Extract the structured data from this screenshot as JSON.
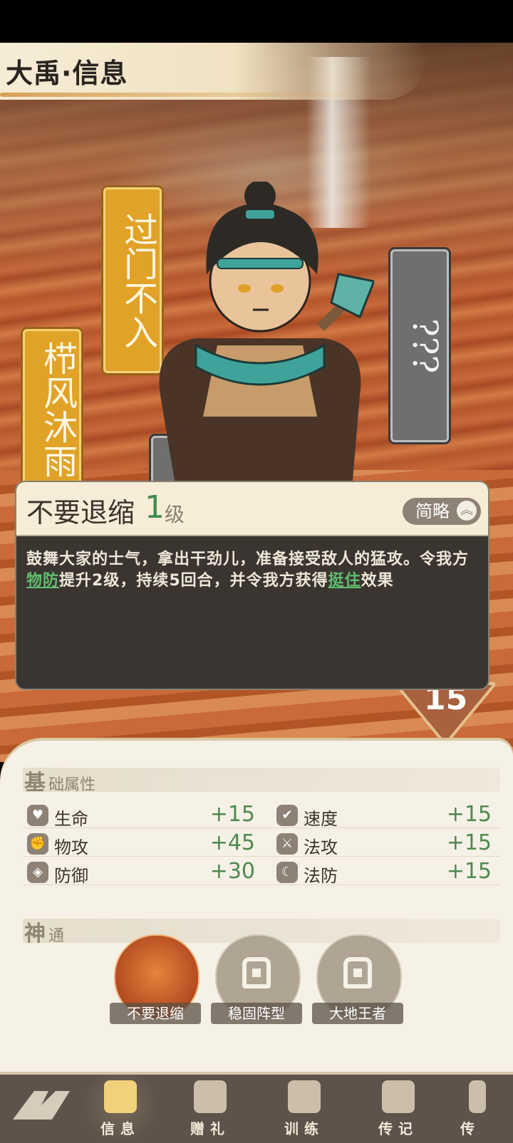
{
  "header": {
    "title": "大禹·信息"
  },
  "tags": {
    "tag1": "过门不入",
    "tag2": "栉风沐雨",
    "tag3": "???"
  },
  "level_badge": "15",
  "skill_popup": {
    "name": "不要退缩",
    "level": "1",
    "level_unit": "级",
    "brief_button": "简略",
    "desc_part1": "鼓舞大家的士气，拿出干劲儿，准备接受敌人的猛攻。令我方",
    "kw1": "物防",
    "desc_part2": "提升2级，持续5回合，并令我方获得",
    "kw2": "挺住",
    "desc_part3": "效果"
  },
  "basic_section": {
    "big": "基",
    "small": "础属性"
  },
  "stats": [
    {
      "label": "生命",
      "value": "+15",
      "icon": "heart-icon"
    },
    {
      "label": "速度",
      "value": "+15",
      "icon": "boot-icon"
    },
    {
      "label": "物攻",
      "value": "+45",
      "icon": "claw-icon"
    },
    {
      "label": "法攻",
      "value": "+15",
      "icon": "sword-icon"
    },
    {
      "label": "防御",
      "value": "+30",
      "icon": "shield-icon"
    },
    {
      "label": "法防",
      "value": "+15",
      "icon": "moon-icon"
    }
  ],
  "power_section": {
    "big": "神",
    "small": "通"
  },
  "powers": [
    {
      "label": "不要退缩"
    },
    {
      "label": "稳固阵型"
    },
    {
      "label": "大地王者"
    }
  ],
  "tabs": [
    {
      "label": "信息"
    },
    {
      "label": "赠礼"
    },
    {
      "label": "训练"
    },
    {
      "label": "传记"
    },
    {
      "label": "传"
    }
  ]
}
